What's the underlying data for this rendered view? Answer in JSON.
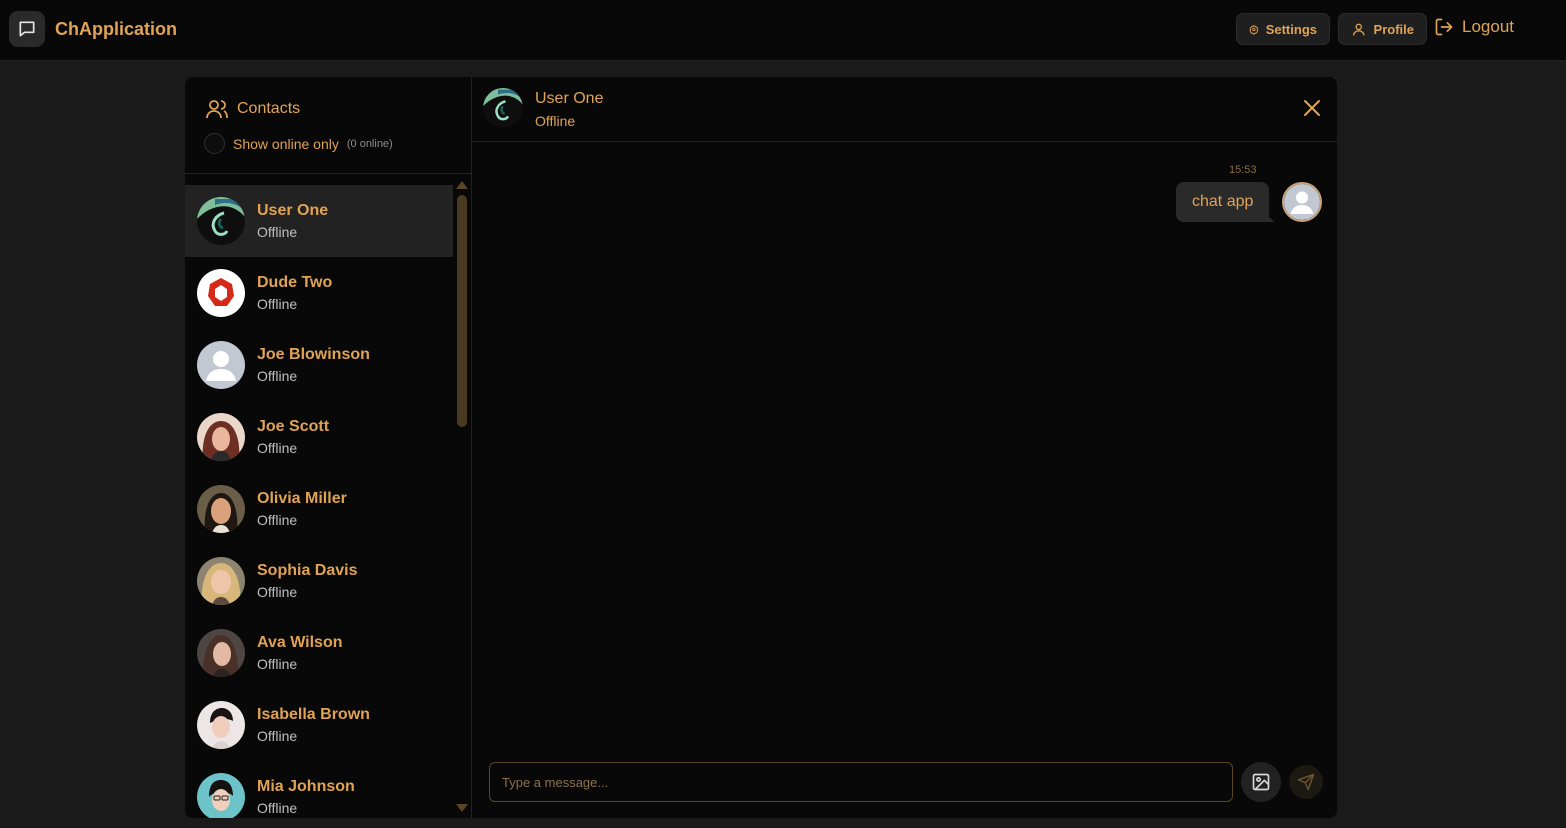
{
  "app": {
    "name": "ChApplication"
  },
  "nav": {
    "settings_label": "Settings",
    "profile_label": "Profile",
    "logout_label": "Logout"
  },
  "sidebar": {
    "title": "Contacts",
    "filter_label": "Show online only",
    "online_count": "(0 online)",
    "contacts": [
      {
        "name": "User One",
        "status": "Offline",
        "avatar": "logo-green",
        "active": true
      },
      {
        "name": "Dude Two",
        "status": "Offline",
        "avatar": "logo-red"
      },
      {
        "name": "Joe Blowinson",
        "status": "Offline",
        "avatar": "default"
      },
      {
        "name": "Joe Scott",
        "status": "Offline",
        "avatar": "photo"
      },
      {
        "name": "Olivia Miller",
        "status": "Offline",
        "avatar": "photo"
      },
      {
        "name": "Sophia Davis",
        "status": "Offline",
        "avatar": "photo"
      },
      {
        "name": "Ava Wilson",
        "status": "Offline",
        "avatar": "photo"
      },
      {
        "name": "Isabella Brown",
        "status": "Offline",
        "avatar": "photo"
      },
      {
        "name": "Mia Johnson",
        "status": "Offline",
        "avatar": "photo"
      }
    ]
  },
  "chat": {
    "partner_name": "User One",
    "partner_status": "Offline",
    "messages": [
      {
        "time": "15:53",
        "text": "chat app"
      }
    ],
    "composer_placeholder": "Type a message..."
  },
  "colors": {
    "accent": "#e0a354",
    "background": "#1a1a1a",
    "panel": "#080808"
  }
}
